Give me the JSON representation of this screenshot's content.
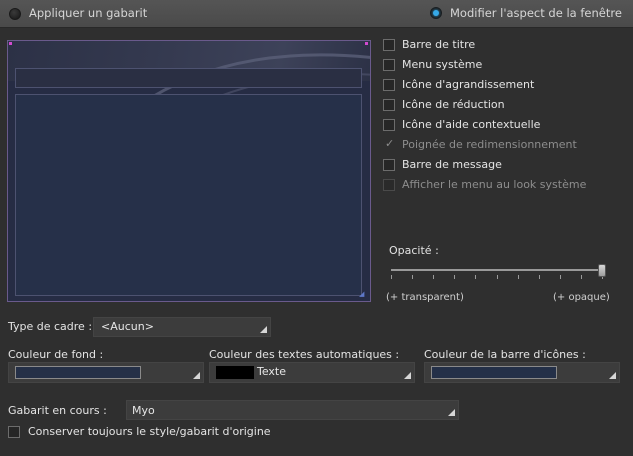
{
  "mode_bar": {
    "options": [
      {
        "label": "Appliquer un gabarit",
        "selected": false
      },
      {
        "label": "Modifier l'aspect de la fenêtre",
        "selected": true
      }
    ]
  },
  "options": [
    {
      "label": "Barre de titre",
      "checked": false,
      "enabled": true
    },
    {
      "label": "Menu système",
      "checked": false,
      "enabled": true
    },
    {
      "label": "Icône d'agrandissement",
      "checked": false,
      "enabled": true
    },
    {
      "label": "Icône de réduction",
      "checked": false,
      "enabled": true
    },
    {
      "label": "Icône d'aide contextuelle",
      "checked": false,
      "enabled": true
    },
    {
      "label": "Poignée de redimensionnement",
      "checked": true,
      "enabled": false
    },
    {
      "label": "Barre de message",
      "checked": false,
      "enabled": true
    },
    {
      "label": "Afficher le menu au look système",
      "checked": false,
      "enabled": false
    }
  ],
  "opacity": {
    "label": "Opacité :",
    "min_label": "(+ transparent)",
    "max_label": "(+ opaque)",
    "level": 1.0
  },
  "frame_type": {
    "label": "Type de cadre :",
    "value": "<Aucun>"
  },
  "colors": {
    "background": {
      "label": "Couleur de fond :",
      "swatch": "#253047"
    },
    "auto_text": {
      "label": "Couleur des textes automatiques :",
      "swatch": "#000000",
      "text": "Texte"
    },
    "icon_bar": {
      "label": "Couleur de la barre d'icônes :",
      "swatch": "#243048"
    }
  },
  "template": {
    "label": "Gabarit en cours :",
    "value": "Myo"
  },
  "keep_style": {
    "label": "Conserver toujours le style/gabarit d'origine",
    "checked": false
  },
  "theme": {
    "accent": "#36a9e8",
    "preview_border": "#6a5a8c",
    "corner_marker": "#d04ad0"
  }
}
